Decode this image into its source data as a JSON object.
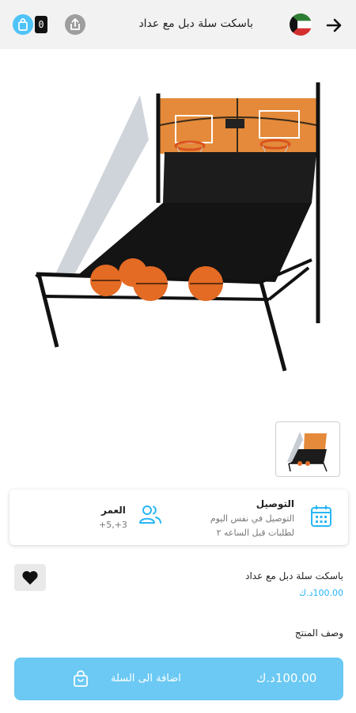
{
  "header": {
    "title": "باسكت سلة دبل مع عداد",
    "cart_count": "0"
  },
  "icons": {
    "back": "arrow-right-icon",
    "flag": "kuwait-flag-icon",
    "share": "share-icon",
    "cart": "shopping-bag-icon",
    "calendar": "calendar-icon",
    "people": "people-icon",
    "favorite": "heart-icon"
  },
  "info": {
    "delivery_title": "التوصيل",
    "delivery_line1": "التوصيل في نفس اليوم",
    "delivery_line2": "لطلبات قبل الساعه ٢",
    "age_title": "العمر",
    "age_value": "+5,+3"
  },
  "product": {
    "name": "باسكت سلة دبل مع عداد",
    "price": "100.00د.ك",
    "description_title": "وصف المنتج"
  },
  "add_bar": {
    "price": "100.00د.ك",
    "label": "اضافة الى السلة"
  },
  "colors": {
    "accent": "#29b6f6",
    "button": "#6bc9f3",
    "header_bg": "#f2f2f2"
  }
}
